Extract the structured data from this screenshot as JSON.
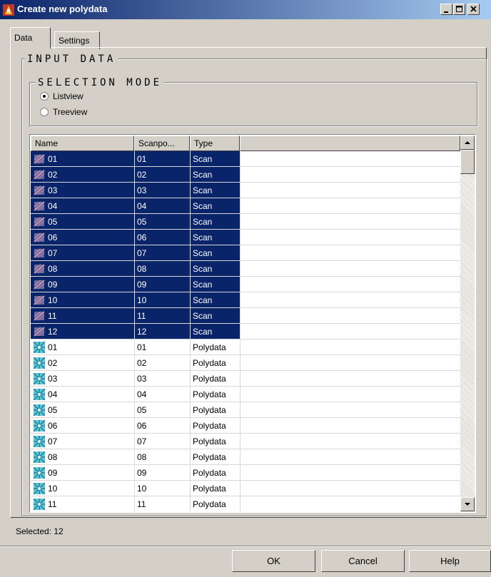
{
  "window": {
    "title": "Create new polydata"
  },
  "tabs": [
    {
      "label": "Data"
    },
    {
      "label": "Settings"
    }
  ],
  "input_data": {
    "label": "INPUT DATA",
    "selection_mode": {
      "label": "SELECTION MODE",
      "options": [
        {
          "label": "Listview",
          "checked": true
        },
        {
          "label": "Treeview",
          "checked": false
        }
      ]
    }
  },
  "list": {
    "columns": [
      "Name",
      "Scanpo...",
      "Type"
    ],
    "rows": [
      {
        "name": "01",
        "scanpos": "01",
        "type": "Scan",
        "icon": "scan-icon",
        "selected": true
      },
      {
        "name": "02",
        "scanpos": "02",
        "type": "Scan",
        "icon": "scan-icon",
        "selected": true
      },
      {
        "name": "03",
        "scanpos": "03",
        "type": "Scan",
        "icon": "scan-icon",
        "selected": true
      },
      {
        "name": "04",
        "scanpos": "04",
        "type": "Scan",
        "icon": "scan-icon",
        "selected": true
      },
      {
        "name": "05",
        "scanpos": "05",
        "type": "Scan",
        "icon": "scan-icon",
        "selected": true
      },
      {
        "name": "06",
        "scanpos": "06",
        "type": "Scan",
        "icon": "scan-icon",
        "selected": true
      },
      {
        "name": "07",
        "scanpos": "07",
        "type": "Scan",
        "icon": "scan-icon",
        "selected": true
      },
      {
        "name": "08",
        "scanpos": "08",
        "type": "Scan",
        "icon": "scan-icon",
        "selected": true
      },
      {
        "name": "09",
        "scanpos": "09",
        "type": "Scan",
        "icon": "scan-icon",
        "selected": true
      },
      {
        "name": "10",
        "scanpos": "10",
        "type": "Scan",
        "icon": "scan-icon",
        "selected": true
      },
      {
        "name": "11",
        "scanpos": "11",
        "type": "Scan",
        "icon": "scan-icon",
        "selected": true
      },
      {
        "name": "12",
        "scanpos": "12",
        "type": "Scan",
        "icon": "scan-icon",
        "selected": true
      },
      {
        "name": "01",
        "scanpos": "01",
        "type": "Polydata",
        "icon": "polydata-icon",
        "selected": false
      },
      {
        "name": "02",
        "scanpos": "02",
        "type": "Polydata",
        "icon": "polydata-icon",
        "selected": false
      },
      {
        "name": "03",
        "scanpos": "03",
        "type": "Polydata",
        "icon": "polydata-icon",
        "selected": false
      },
      {
        "name": "04",
        "scanpos": "04",
        "type": "Polydata",
        "icon": "polydata-icon",
        "selected": false
      },
      {
        "name": "05",
        "scanpos": "05",
        "type": "Polydata",
        "icon": "polydata-icon",
        "selected": false
      },
      {
        "name": "06",
        "scanpos": "06",
        "type": "Polydata",
        "icon": "polydata-icon",
        "selected": false
      },
      {
        "name": "07",
        "scanpos": "07",
        "type": "Polydata",
        "icon": "polydata-icon",
        "selected": false
      },
      {
        "name": "08",
        "scanpos": "08",
        "type": "Polydata",
        "icon": "polydata-icon",
        "selected": false
      },
      {
        "name": "09",
        "scanpos": "09",
        "type": "Polydata",
        "icon": "polydata-icon",
        "selected": false
      },
      {
        "name": "10",
        "scanpos": "10",
        "type": "Polydata",
        "icon": "polydata-icon",
        "selected": false
      },
      {
        "name": "11",
        "scanpos": "11",
        "type": "Polydata",
        "icon": "polydata-icon",
        "selected": false
      }
    ]
  },
  "status": {
    "selected": "Selected: 12"
  },
  "buttons": {
    "ok": "OK",
    "cancel": "Cancel",
    "help": "Help"
  },
  "colors": {
    "selection": "#0a246a",
    "titlebar": "#0a246a",
    "face": "#d4d0c8"
  }
}
